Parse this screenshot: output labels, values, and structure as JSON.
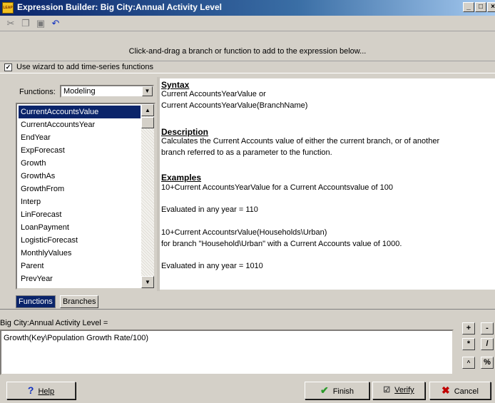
{
  "window": {
    "title": "Expression Builder: Big City:Annual Activity Level",
    "app_icon_text": "LEAP",
    "controls": [
      "_",
      "□",
      "×"
    ]
  },
  "toolbar": {
    "icons": [
      "cut-icon",
      "copy-icon",
      "paste-icon",
      "undo-icon"
    ],
    "glyphs": [
      "✂",
      "❐",
      "▣",
      "↶"
    ]
  },
  "instruction": "Click-and-drag a branch or function to add to the expression below...",
  "wizard": {
    "checked": true,
    "label": "Use wizard to add time-series functions"
  },
  "functions_panel": {
    "label": "Functions:",
    "selected_category": "Modeling",
    "items": [
      "CurrentAccountsValue",
      "CurrentAccountsYear",
      "EndYear",
      "ExpForecast",
      "Growth",
      "GrowthAs",
      "GrowthFrom",
      "Interp",
      "LinForecast",
      "LoanPayment",
      "LogisticForecast",
      "MonthlyValues",
      "Parent",
      "PrevYear"
    ],
    "selected_index": 0
  },
  "help": {
    "syntax_heading": "Syntax",
    "syntax_lines": [
      "Current AccountsYearValue or",
      "Current AccountsYearValue(BranchName)"
    ],
    "description_heading": "Description",
    "description_lines": [
      "Calculates the Current Accounts value of either the current branch, or of another",
      "branch referred to as a parameter to the function."
    ],
    "examples_heading": "Examples",
    "examples_lines": [
      "10+Current AccountsYearValue for a Current Accountsvalue of 100",
      "Evaluated in any year = 110",
      "10+Current AccountsrValue(Households\\Urban)",
      "for branch \"Household\\Urban\" with a Current Accounts value of 1000.",
      "Evaluated in any year = 1010"
    ]
  },
  "tabs": [
    "Functions",
    "Branches"
  ],
  "expression": {
    "label": "Big City:Annual Activity Level =",
    "value": "Growth(Key\\Population Growth Rate/100)"
  },
  "operators": [
    "+",
    "-",
    "*",
    "/",
    "^",
    "%"
  ],
  "buttons": {
    "help": "Help",
    "finish": "Finish",
    "verify": "Verify",
    "cancel": "Cancel"
  },
  "colors": {
    "title_bar": "#0a246a",
    "selection": "#0a246a",
    "finish_check": "#2a9a2a",
    "cancel_x": "#c00000",
    "help_icon": "#1030c0"
  }
}
